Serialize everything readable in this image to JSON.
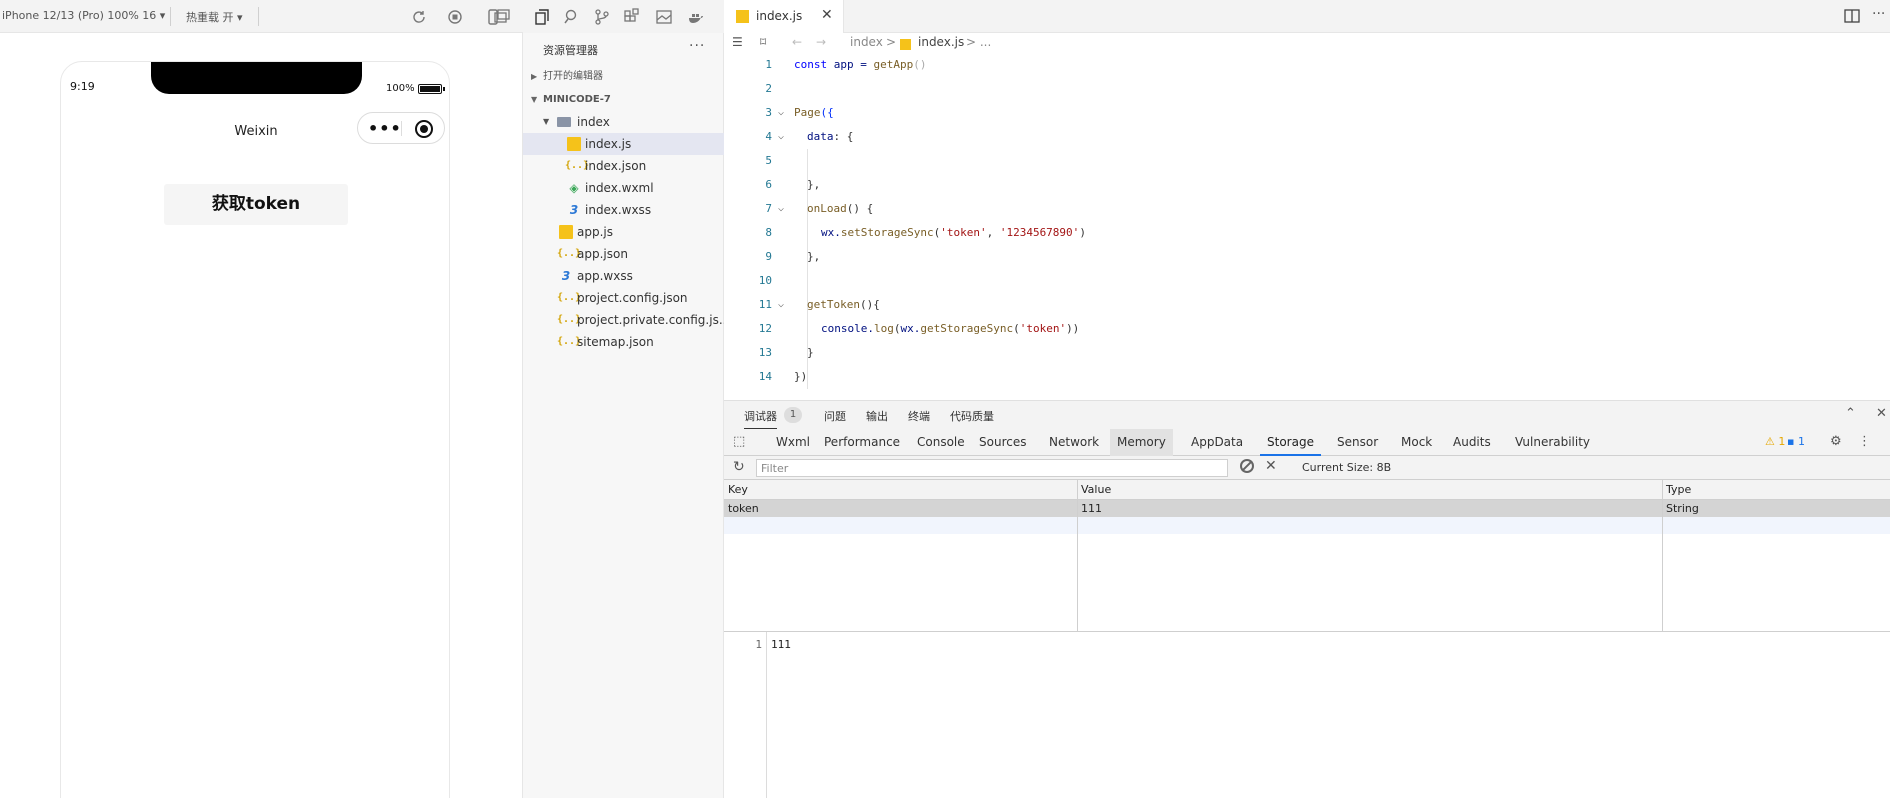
{
  "simulator": {
    "device": "iPhone 12/13 (Pro) 100% 16 ▾",
    "hot_reload": "热重载 开 ▾",
    "status_time": "9:19",
    "battery_pct": "100%",
    "nav_title": "Weixin",
    "capsule_more": "•••",
    "token_button": "获取token"
  },
  "explorer": {
    "title": "资源管理器",
    "more": "···",
    "open_editors": "打开的编辑器",
    "project": "MINICODE-7",
    "tree": [
      {
        "label": "index",
        "type": "folder"
      },
      {
        "label": "index.js",
        "type": "js"
      },
      {
        "label": "index.json",
        "type": "json"
      },
      {
        "label": "index.wxml",
        "type": "wxml"
      },
      {
        "label": "index.wxss",
        "type": "wxss"
      },
      {
        "label": "app.js",
        "type": "js"
      },
      {
        "label": "app.json",
        "type": "json"
      },
      {
        "label": "app.wxss",
        "type": "wxss"
      },
      {
        "label": "project.config.json",
        "type": "json"
      },
      {
        "label": "project.private.config.js...",
        "type": "json"
      },
      {
        "label": "sitemap.json",
        "type": "json"
      }
    ],
    "json_glyph": "{..}",
    "wxml_glyph": "◈",
    "wxss_glyph": "3"
  },
  "editor": {
    "tab_label": "index.js",
    "tab_close": "✕",
    "more": "···",
    "breadcrumb": {
      "folder": "index",
      "sep": ">",
      "file": "index.js",
      "tail": "> ..."
    },
    "nav_back": "←",
    "nav_forward": "→",
    "line_numbers": [
      "1",
      "2",
      "3",
      "4",
      "5",
      "6",
      "7",
      "8",
      "9",
      "10",
      "11",
      "12",
      "13",
      "14"
    ],
    "code": {
      "l1_kw": "const",
      "l1_var": " app = ",
      "l1_fn": "getApp",
      "l1_paren": "()",
      "l3_fn": "Page",
      "l3_brace": "({",
      "l4_prop": "data",
      "l4_rest": ": {",
      "l6": "},",
      "l7_fn": "onLoad",
      "l7_rest": "() {",
      "l8_obj": "wx.",
      "l8_fn": "setStorageSync",
      "l8_open": "(",
      "l8_s1": "'token'",
      "l8_comma": ", ",
      "l8_s2": "'1234567890'",
      "l8_close": ")",
      "l9": "},",
      "l11_fn": "getToken",
      "l11_rest": "(){",
      "l12_obj": "console.",
      "l12_fn": "log",
      "l12_open": "(",
      "l12_wx": "wx.",
      "l12_fn2": "getStorageSync",
      "l12_open2": "(",
      "l12_s": "'token'",
      "l12_close": "))",
      "l13": "}",
      "l14": "})"
    },
    "fold_glyph": "⌵"
  },
  "debugger": {
    "tabs": [
      "调试器",
      "问题",
      "输出",
      "终端",
      "代码质量"
    ],
    "badge": "1",
    "devtools_tabs": [
      "Wxml",
      "Performance",
      "Console",
      "Sources",
      "Network",
      "Memory",
      "AppData",
      "Storage",
      "Sensor",
      "Mock",
      "Audits",
      "Vulnerability"
    ],
    "active_tab": "Storage",
    "warn_count": "⚠ 1",
    "info_count": "▪ 1",
    "filter_placeholder": "Filter",
    "current_size": "Current Size: 8B",
    "columns": [
      "Key",
      "Value",
      "Type"
    ],
    "rows": [
      {
        "key": "token",
        "value": "111",
        "type": "String"
      }
    ],
    "preview": {
      "line": "1",
      "value": "111"
    },
    "collapse": "⌃",
    "close": "✕",
    "settings": "⚙",
    "more": "⋮"
  }
}
